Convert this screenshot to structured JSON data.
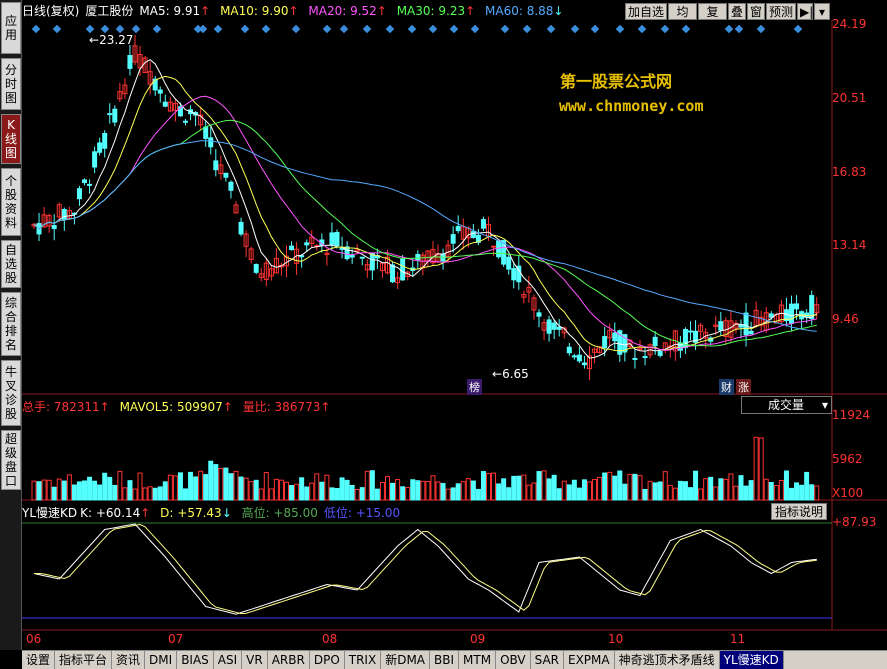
{
  "sidebar": {
    "items": [
      {
        "label": "应用",
        "chars": [
          "应",
          "用"
        ]
      },
      {
        "label": "分时图",
        "chars": [
          "分",
          "时",
          "图"
        ]
      },
      {
        "label": "K线图",
        "chars": [
          "K",
          "线",
          "图"
        ]
      },
      {
        "label": "个股资料",
        "chars": [
          "个",
          "股",
          "资",
          "料"
        ]
      },
      {
        "label": "自选股",
        "chars": [
          "自",
          "选",
          "股"
        ]
      },
      {
        "label": "综合排名",
        "chars": [
          "综",
          "合",
          "排",
          "名"
        ]
      },
      {
        "label": "牛叉诊股",
        "chars": [
          "牛",
          "叉",
          "诊",
          "股"
        ]
      },
      {
        "label": "超级盘口",
        "chars": [
          "超",
          "级",
          "盘",
          "口"
        ]
      }
    ],
    "active_index": 2
  },
  "header": {
    "period": "日线(复权)",
    "stock_name": "厦工股份",
    "ma5": "MA5: 9.91",
    "ma10": "MA10: 9.90",
    "ma20": "MA20: 9.52",
    "ma30": "MA30: 9.23",
    "ma60": "MA60: 8.88"
  },
  "toolbar": {
    "watchlist": "加自选",
    "avg_line": "均线",
    "restore": "复权",
    "overlay": "叠",
    "window": "窗",
    "forecast": "预测"
  },
  "price_axis": [
    "24.19",
    "20.51",
    "16.83",
    "13.14",
    "9.46"
  ],
  "annotations": {
    "high": "23.27",
    "low": "6.65",
    "badge_list": "榜",
    "badge_finance": "财",
    "badge_rise": "涨"
  },
  "watermark": {
    "title": "第一股票公式网",
    "url": "www.chnmoney.com"
  },
  "volume": {
    "total": "总手: 782311",
    "mavol5": "MAVOL5: 509907",
    "ratio": "量比: 386773",
    "dropdown": "成交量",
    "axis": [
      "11924",
      "5962",
      "X100"
    ]
  },
  "indicator": {
    "name": "YL慢速KD",
    "k": "K: +60.14",
    "d": "D: +57.43",
    "high": "高位: +85.00",
    "low": "低位: +15.00",
    "help": "指标说明",
    "axis_top": "+87.93"
  },
  "dates": [
    "06",
    "07",
    "08",
    "09",
    "10",
    "11"
  ],
  "tabs": [
    "设置",
    "指标平台",
    "资讯",
    "DMI",
    "BIAS",
    "ASI",
    "VR",
    "ARBR",
    "DPO",
    "TRIX",
    "新DMA",
    "BBI",
    "MTM",
    "OBV",
    "SAR",
    "EXPMA",
    "神奇逃顶术矛盾线",
    "YL慢速KD"
  ],
  "active_tab": "YL慢速KD",
  "colors": {
    "up": "#ff3333",
    "down": "#54ffff",
    "ma5": "#ffffff",
    "ma10": "#ffff55",
    "ma20": "#ff55ff",
    "ma30": "#55ff55",
    "ma60": "#55aaff",
    "grid": "#8a1a1a"
  }
}
